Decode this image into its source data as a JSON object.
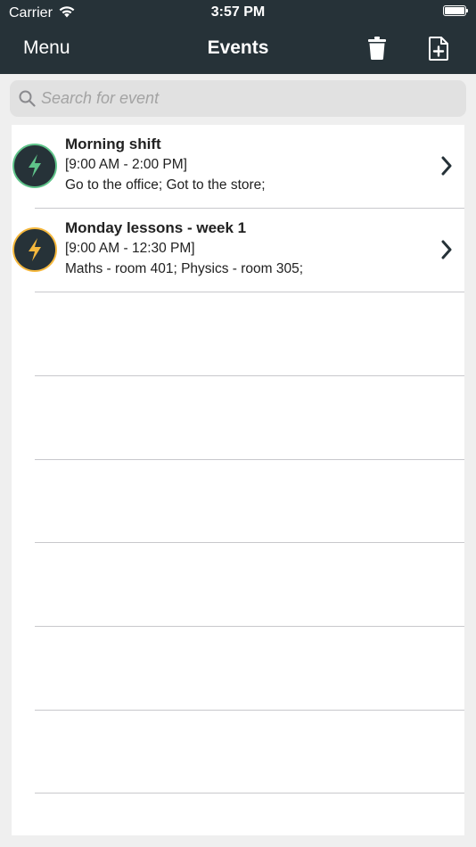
{
  "status_bar": {
    "carrier": "Carrier",
    "time": "3:57 PM",
    "wifi_icon": "wifi-icon",
    "battery_icon": "battery-icon"
  },
  "nav_bar": {
    "menu_label": "Menu",
    "title": "Events",
    "delete_icon": "trash-icon",
    "add_icon": "add-document-icon",
    "background": "#263238"
  },
  "search": {
    "placeholder": "Search for event",
    "value": ""
  },
  "events": [
    {
      "title": "Morning shift",
      "time": "[9:00 AM - 2:00 PM]",
      "description": "Go to the office; Got to the store;",
      "icon": "lightning-icon",
      "accent_color": "#5fc48a"
    },
    {
      "title": "Monday lessons - week 1",
      "time": "[9:00 AM - 12:30 PM]",
      "description": "Maths - room 401; Physics - room 305;",
      "icon": "lightning-icon",
      "accent_color": "#f5b83d"
    }
  ]
}
